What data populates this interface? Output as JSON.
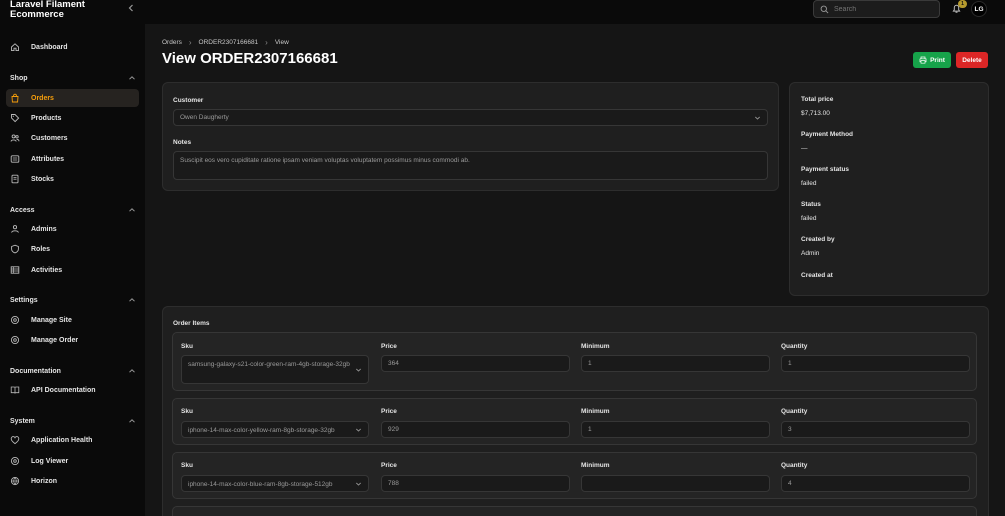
{
  "brand": {
    "line1": "Laravel Filament",
    "line2": "Ecommerce"
  },
  "nav": {
    "dashboard": "Dashboard",
    "groups": {
      "shop": "Shop",
      "access": "Access",
      "settings": "Settings",
      "documentation": "Documentation",
      "system": "System"
    },
    "orders": "Orders",
    "products": "Products",
    "customers": "Customers",
    "attributes": "Attributes",
    "stocks": "Stocks",
    "admins": "Admins",
    "roles": "Roles",
    "activities": "Activities",
    "manage_site": "Manage Site",
    "manage_order": "Manage Order",
    "api_docs": "API Documentation",
    "app_health": "Application Health",
    "log_viewer": "Log Viewer",
    "horizon": "Horizon"
  },
  "topbar": {
    "search_placeholder": "Search",
    "notifications_count": "1",
    "avatar_initials": "LG"
  },
  "breadcrumbs": [
    "Orders",
    "ORDER2307166681",
    "View"
  ],
  "page_title": "View ORDER2307166681",
  "actions": {
    "print": "Print",
    "delete": "Delete"
  },
  "form": {
    "customer_label": "Customer",
    "customer_value": "Owen Daugherty",
    "notes_label": "Notes",
    "notes_value": "Suscipit eos vero cupiditate ratione ipsam veniam voluptas voluptatem possimus minus commodi ab."
  },
  "summary": {
    "total_price_label": "Total price",
    "total_price": "$7,713.00",
    "payment_method_label": "Payment Method",
    "payment_method": "—",
    "payment_status_label": "Payment status",
    "payment_status": "failed",
    "status_label": "Status",
    "status": "failed",
    "created_by_label": "Created by",
    "created_by": "Admin",
    "created_at_label": "Created at"
  },
  "order_items": {
    "title": "Order Items",
    "headers": {
      "sku": "Sku",
      "price": "Price",
      "minimum": "Minimum",
      "quantity": "Quantity"
    },
    "rows": [
      {
        "sku": "samsung-galaxy-s21-color-green-ram-4gb-storage-32gb",
        "price": "364",
        "minimum": "1",
        "quantity": "1"
      },
      {
        "sku": "iphone-14-max-color-yellow-ram-8gb-storage-32gb",
        "price": "929",
        "minimum": "1",
        "quantity": "3"
      },
      {
        "sku": "iphone-14-max-color-blue-ram-8gb-storage-512gb",
        "price": "788",
        "minimum": "",
        "quantity": "4"
      }
    ]
  },
  "colors": {
    "accent": "#f59e0b",
    "print": "#16a34a",
    "delete": "#dc2626",
    "background": "#151515",
    "sidebar": "#0a0a0a"
  }
}
